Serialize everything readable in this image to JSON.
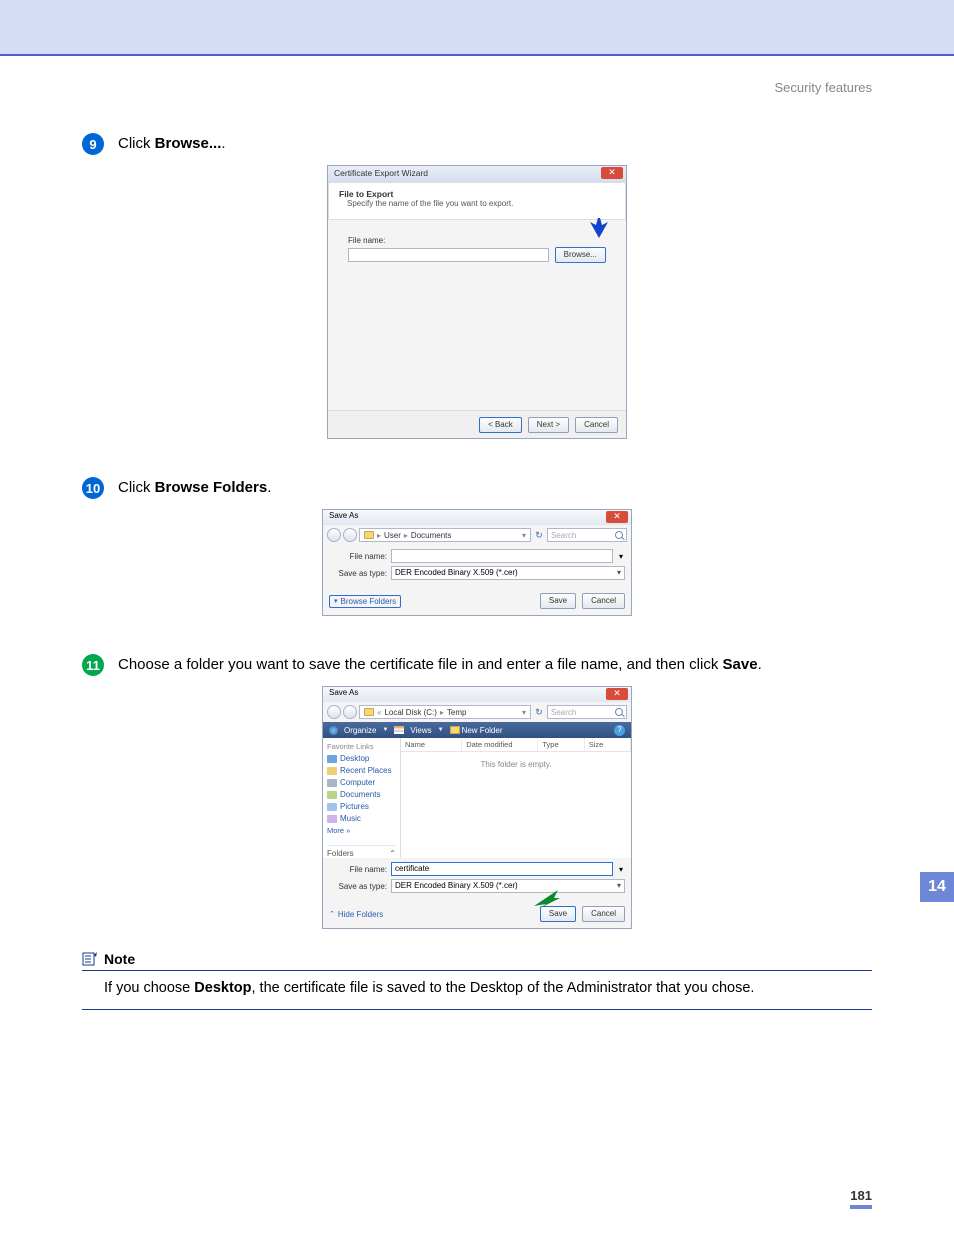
{
  "header": {
    "section": "Security features"
  },
  "steps": {
    "s9": {
      "num": "9",
      "pre": "Click ",
      "bold": "Browse...",
      "post": "."
    },
    "s10": {
      "num": "10",
      "pre": "Click ",
      "bold": "Browse Folders",
      "post": "."
    },
    "s11": {
      "num": "11",
      "pre": "Choose a folder you want to save the certificate file in and enter a file name, and then click ",
      "bold": "Save",
      "post": "."
    }
  },
  "wizard": {
    "title": "Certificate Export Wizard",
    "h1": "File to Export",
    "h2": "Specify the name of the file you want to export.",
    "file_label": "File name:",
    "browse": "Browse...",
    "back": "< Back",
    "next": "Next >",
    "cancel": "Cancel"
  },
  "saveas1": {
    "title": "Save As",
    "crumb_user": "User",
    "crumb_docs": "Documents",
    "search_ph": "Search",
    "file_label": "File name:",
    "type_label": "Save as type:",
    "type_value": "DER Encoded Binary X.509 (*.cer)",
    "browse_folders": "Browse Folders",
    "save": "Save",
    "cancel": "Cancel"
  },
  "saveas2": {
    "title": "Save As",
    "crumb_disk": "Local Disk (C:)",
    "crumb_temp": "Temp",
    "search_ph": "Search",
    "toolbar": {
      "organize": "Organize",
      "views": "Views",
      "newfolder": "New Folder"
    },
    "fav_hd": "Favorite Links",
    "fav": {
      "desktop": "Desktop",
      "recent": "Recent Places",
      "computer": "Computer",
      "documents": "Documents",
      "pictures": "Pictures",
      "music": "Music",
      "more": "More »"
    },
    "folders_hd": "Folders",
    "cols": {
      "name": "Name",
      "date": "Date modified",
      "type": "Type",
      "size": "Size"
    },
    "empty": "This folder is empty.",
    "file_label": "File name:",
    "file_value": "certificate",
    "type_label": "Save as type:",
    "type_value": "DER Encoded Binary X.509 (*.cer)",
    "hide_folders": "Hide Folders",
    "save": "Save",
    "cancel": "Cancel"
  },
  "note": {
    "title": "Note",
    "body_pre": "If you choose ",
    "body_bold": "Desktop",
    "body_post": ", the certificate file is saved to the Desktop of the Administrator that you chose."
  },
  "page": {
    "side_tab": "14",
    "number": "181"
  }
}
